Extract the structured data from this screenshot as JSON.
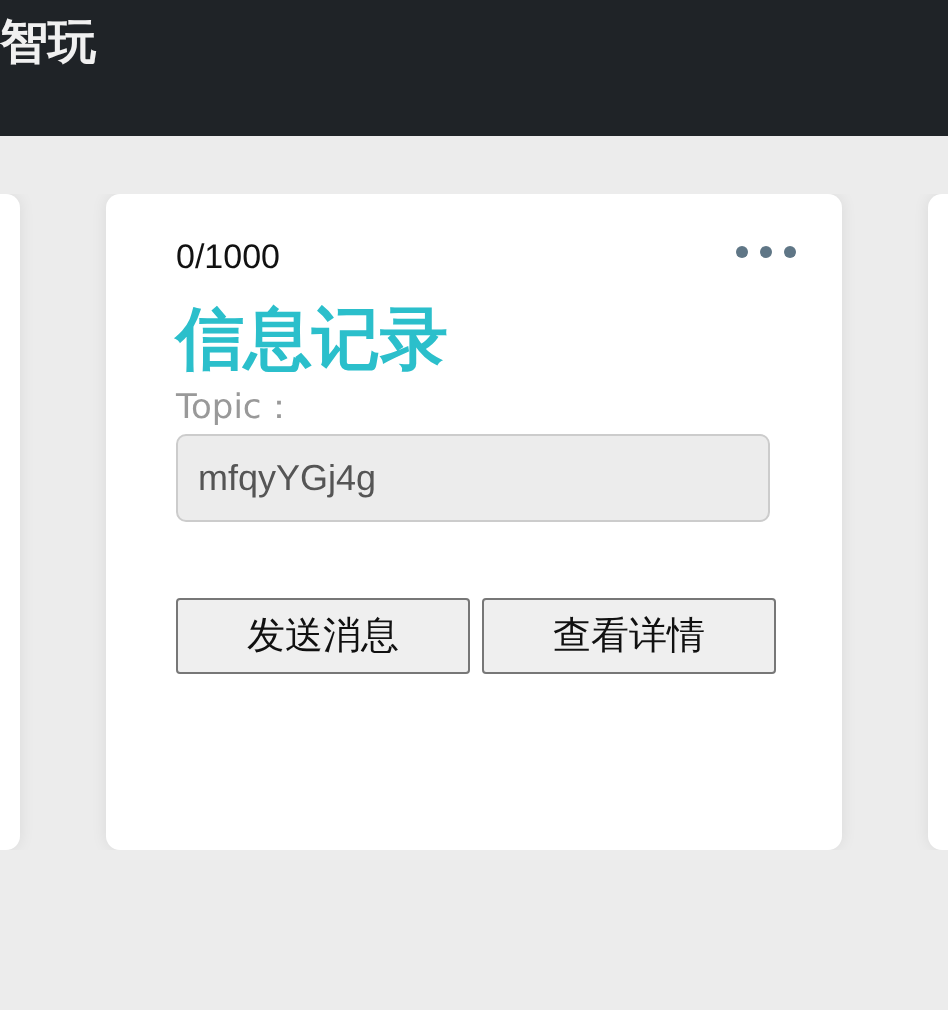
{
  "header": {
    "title": "智玩"
  },
  "card": {
    "counter": "0/1000",
    "title": "信息记录",
    "topic_label": "Topic：",
    "topic_value": "mfqyYGj4g",
    "buttons": [
      "发送消息",
      "查看详情"
    ]
  }
}
